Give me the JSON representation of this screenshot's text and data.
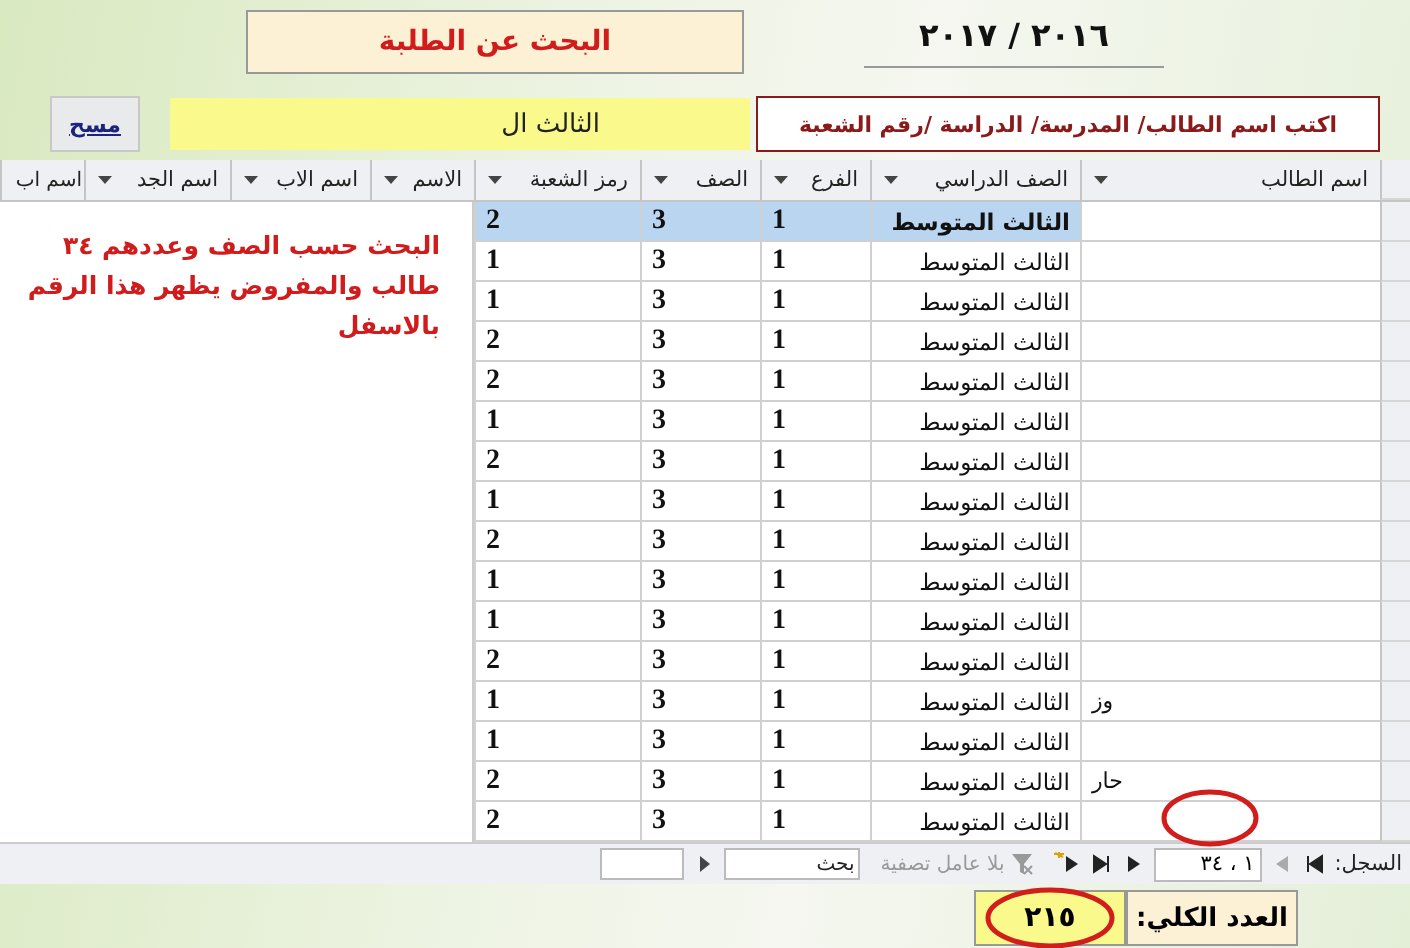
{
  "header": {
    "title": "البحث عن الطلبة",
    "year": "٢٠١٦ / ٢٠١٧"
  },
  "search": {
    "clear_button": "مسح",
    "value": "الثالث ال",
    "hint": "اكتب اسم الطالب/ المدرسة/ الدراسة /رقم الشعبة"
  },
  "table": {
    "columns": [
      {
        "label": "اسم الطالب",
        "dropdown": true
      },
      {
        "label": "الصف الدراسي",
        "dropdown": true
      },
      {
        "label": "الفرع",
        "dropdown": true
      },
      {
        "label": "الصف",
        "dropdown": true
      },
      {
        "label": "رمز الشعبة",
        "dropdown": true
      },
      {
        "label": "الاسم",
        "dropdown": true
      },
      {
        "label": "اسم الاب",
        "dropdown": true
      },
      {
        "label": "اسم الجد",
        "dropdown": true
      },
      {
        "label": "اسم اب",
        "dropdown": false
      }
    ],
    "rows": [
      {
        "name": "",
        "stage": "الثالث المتوسط",
        "branch": "1",
        "grade": "3",
        "section": "2",
        "selected": true
      },
      {
        "name": "",
        "stage": "الثالث المتوسط",
        "branch": "1",
        "grade": "3",
        "section": "1",
        "selected": false
      },
      {
        "name": "",
        "stage": "الثالث المتوسط",
        "branch": "1",
        "grade": "3",
        "section": "1",
        "selected": false
      },
      {
        "name": "",
        "stage": "الثالث المتوسط",
        "branch": "1",
        "grade": "3",
        "section": "2",
        "selected": false
      },
      {
        "name": "",
        "stage": "الثالث المتوسط",
        "branch": "1",
        "grade": "3",
        "section": "2",
        "selected": false
      },
      {
        "name": "",
        "stage": "الثالث المتوسط",
        "branch": "1",
        "grade": "3",
        "section": "1",
        "selected": false
      },
      {
        "name": "",
        "stage": "الثالث المتوسط",
        "branch": "1",
        "grade": "3",
        "section": "2",
        "selected": false
      },
      {
        "name": "",
        "stage": "الثالث المتوسط",
        "branch": "1",
        "grade": "3",
        "section": "1",
        "selected": false
      },
      {
        "name": "",
        "stage": "الثالث المتوسط",
        "branch": "1",
        "grade": "3",
        "section": "2",
        "selected": false
      },
      {
        "name": "",
        "stage": "الثالث المتوسط",
        "branch": "1",
        "grade": "3",
        "section": "1",
        "selected": false
      },
      {
        "name": "",
        "stage": "الثالث المتوسط",
        "branch": "1",
        "grade": "3",
        "section": "1",
        "selected": false
      },
      {
        "name": "",
        "stage": "الثالث المتوسط",
        "branch": "1",
        "grade": "3",
        "section": "2",
        "selected": false
      },
      {
        "name": "وز",
        "stage": "الثالث المتوسط",
        "branch": "1",
        "grade": "3",
        "section": "1",
        "selected": false
      },
      {
        "name": "",
        "stage": "الثالث المتوسط",
        "branch": "1",
        "grade": "3",
        "section": "1",
        "selected": false
      },
      {
        "name": "حار",
        "stage": "الثالث المتوسط",
        "branch": "1",
        "grade": "3",
        "section": "2",
        "selected": false
      },
      {
        "name": "",
        "stage": "الثالث المتوسط",
        "branch": "1",
        "grade": "3",
        "section": "2",
        "selected": false
      }
    ]
  },
  "note": "البحث حسب الصف وعددهم ٣٤ طالب والمفروض يظهر هذا الرقم بالاسفل",
  "navigation": {
    "label": "السجل:",
    "record": "١ ، ٣٤",
    "filter": "بلا عامل تصفية",
    "search_placeholder": "بحث"
  },
  "total": {
    "label": "العدد الكلي:",
    "value": "٢١٥"
  }
}
